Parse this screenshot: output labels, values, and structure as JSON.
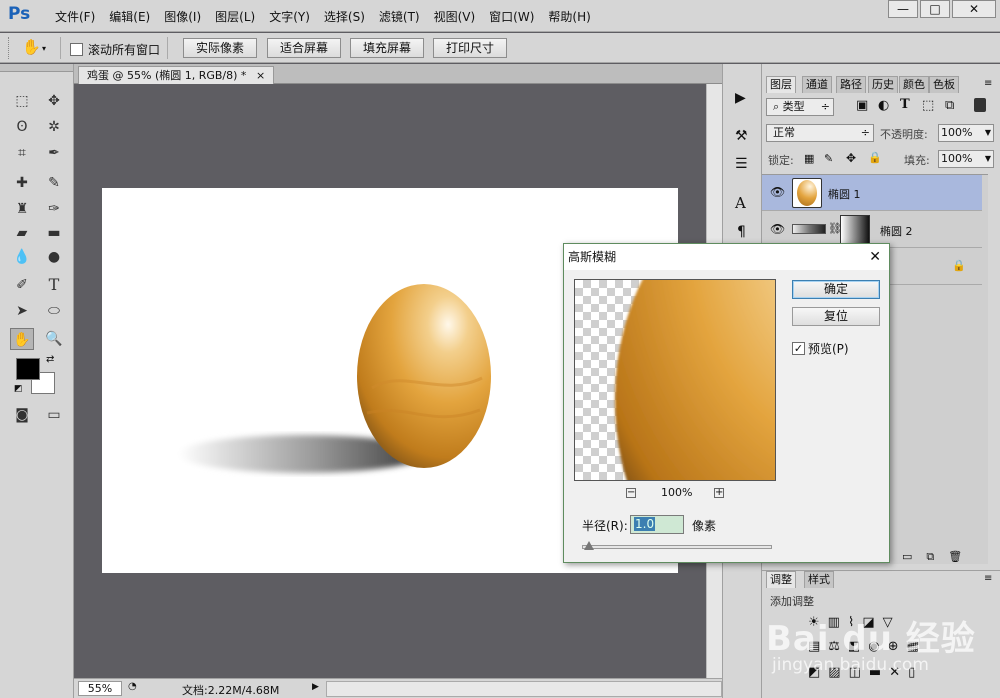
{
  "app": {
    "logo": "Ps"
  },
  "menu": [
    "文件(F)",
    "编辑(E)",
    "图像(I)",
    "图层(L)",
    "文字(Y)",
    "选择(S)",
    "滤镜(T)",
    "视图(V)",
    "窗口(W)",
    "帮助(H)"
  ],
  "window_controls": {
    "minimize": "—",
    "maximize": "□",
    "close": "✕"
  },
  "options_bar": {
    "scroll_all_label": "滚动所有窗口",
    "buttons": [
      "实际像素",
      "适合屏幕",
      "填充屏幕",
      "打印尺寸"
    ]
  },
  "document": {
    "tab_title": "鸡蛋 @ 55% (椭圆 1, RGB/8) *",
    "tab_close": "×",
    "zoom": "55%",
    "doc_info": "文档:2.22M/4.68M"
  },
  "layers_panel": {
    "tabs": [
      "图层",
      "通道",
      "路径",
      "历史",
      "颜色",
      "色板"
    ],
    "filter_kind": "类型",
    "blend_mode": "正常",
    "opacity_label": "不透明度:",
    "opacity_value": "100%",
    "lock_label": "锁定:",
    "fill_label": "填充:",
    "fill_value": "100%",
    "layers": [
      {
        "name": "椭圆 1",
        "selected": true
      },
      {
        "name": "椭圆 2",
        "selected": false
      }
    ]
  },
  "adjust_panel": {
    "tabs": [
      "调整",
      "样式"
    ],
    "add_label": "添加调整"
  },
  "dialog": {
    "title": "高斯模糊",
    "ok": "确定",
    "reset": "复位",
    "preview_label": "预览(P)",
    "preview_checked": true,
    "zoom": "100%",
    "radius_label": "半径(R):",
    "radius_value": "1.0",
    "unit": "像素"
  },
  "colors": {
    "selected_layer": "#a9b8dd",
    "egg": "#e3a43e",
    "accent": "#3c7fb1"
  },
  "watermark": {
    "brand": "Bai du 经验",
    "url": "jingyan.baidu.com"
  }
}
